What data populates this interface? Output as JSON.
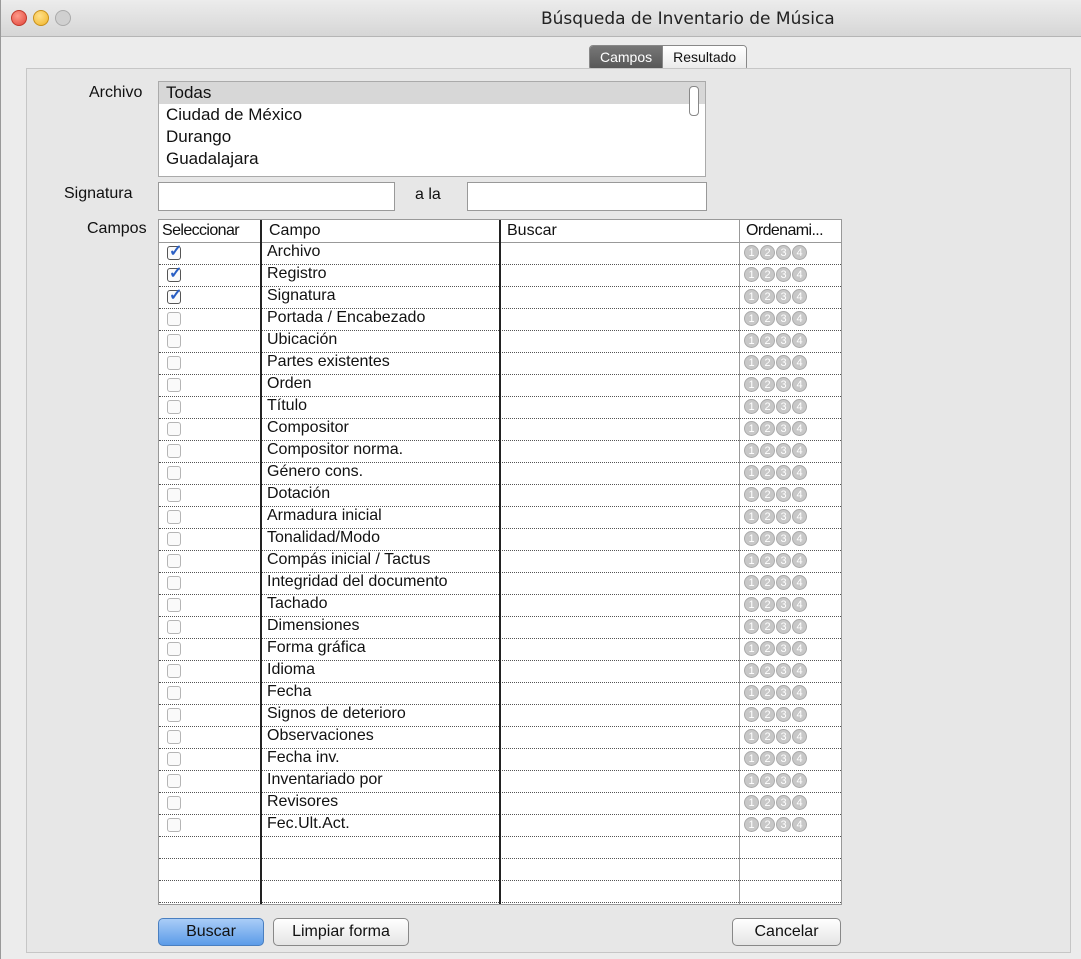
{
  "window": {
    "title": "Búsqueda de Inventario de Música"
  },
  "tabs": {
    "campos": "Campos",
    "resultado": "Resultado"
  },
  "archivo": {
    "label": "Archivo",
    "items": [
      "Todas",
      "Ciudad de México",
      "Durango",
      "Guadalajara"
    ]
  },
  "signatura": {
    "label": "Signatura",
    "to_label": "a la",
    "from_value": "",
    "to_value": ""
  },
  "campos": {
    "label": "Campos",
    "headers": {
      "select": "Seleccionar",
      "field": "Campo",
      "search": "Buscar",
      "order": "Ordenami..."
    },
    "order_digits": [
      "1",
      "2",
      "3",
      "4"
    ],
    "rows": [
      {
        "name": "Archivo",
        "checked": true
      },
      {
        "name": "Registro",
        "checked": true
      },
      {
        "name": "Signatura",
        "checked": true
      },
      {
        "name": "Portada / Encabezado",
        "checked": false
      },
      {
        "name": "Ubicación",
        "checked": false
      },
      {
        "name": "Partes existentes",
        "checked": false
      },
      {
        "name": "Orden",
        "checked": false
      },
      {
        "name": "Título",
        "checked": false
      },
      {
        "name": "Compositor",
        "checked": false
      },
      {
        "name": "Compositor norma.",
        "checked": false
      },
      {
        "name": "Género cons.",
        "checked": false
      },
      {
        "name": "Dotación",
        "checked": false
      },
      {
        "name": "Armadura inicial",
        "checked": false
      },
      {
        "name": "Tonalidad/Modo",
        "checked": false
      },
      {
        "name": "Compás inicial / Tactus",
        "checked": false
      },
      {
        "name": "Integridad del documento",
        "checked": false
      },
      {
        "name": "Tachado",
        "checked": false
      },
      {
        "name": "Dimensiones",
        "checked": false
      },
      {
        "name": "Forma gráfica",
        "checked": false
      },
      {
        "name": "Idioma",
        "checked": false
      },
      {
        "name": "Fecha",
        "checked": false
      },
      {
        "name": "Signos de deterioro",
        "checked": false
      },
      {
        "name": "Observaciones",
        "checked": false
      },
      {
        "name": "Fecha inv.",
        "checked": false
      },
      {
        "name": "Inventariado por",
        "checked": false
      },
      {
        "name": "Revisores",
        "checked": false
      },
      {
        "name": "Fec.Ult.Act.",
        "checked": false
      }
    ]
  },
  "buttons": {
    "search": "Buscar",
    "clear": "Limpiar forma",
    "cancel": "Cancelar"
  },
  "colors": {
    "check_mark": "#2a5fc4",
    "primary_button": "#5b9be8"
  }
}
